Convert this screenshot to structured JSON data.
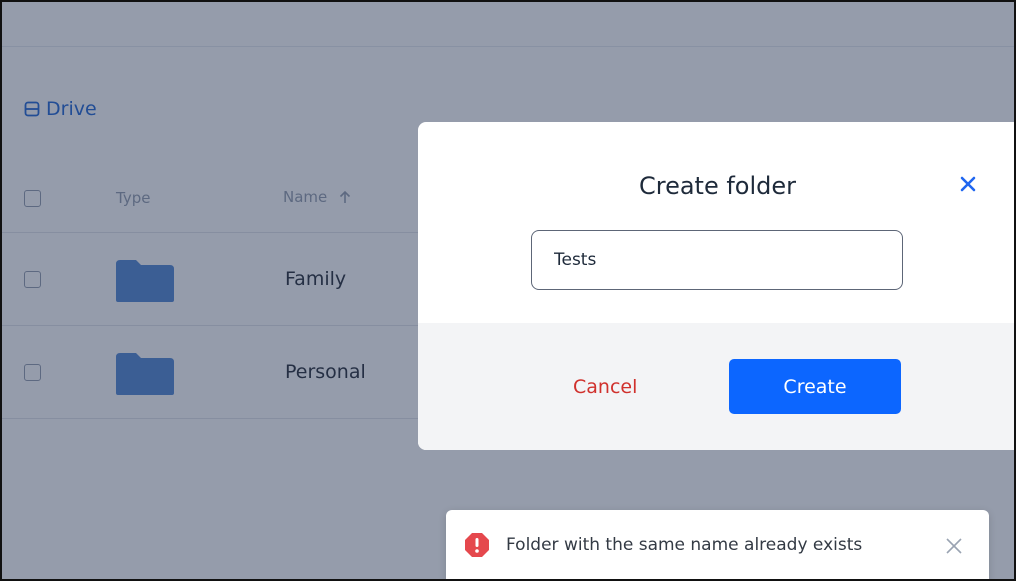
{
  "breadcrumb": {
    "label": "Drive",
    "icon": "drive-icon"
  },
  "table": {
    "headers": {
      "type": "Type",
      "name": "Name"
    },
    "rows": [
      {
        "name": "Family",
        "icon": "folder-icon"
      },
      {
        "name": "Personal",
        "icon": "folder-icon"
      }
    ]
  },
  "modal": {
    "title": "Create folder",
    "input_value": "Tests",
    "cancel_label": "Cancel",
    "create_label": "Create",
    "close_icon": "close-icon"
  },
  "toast": {
    "message": "Folder with the same name already exists",
    "icon": "error-icon",
    "close_icon": "close-icon"
  },
  "colors": {
    "accent": "#0c66ff",
    "danger": "#d0312d",
    "folder": "#5b8fd6"
  }
}
